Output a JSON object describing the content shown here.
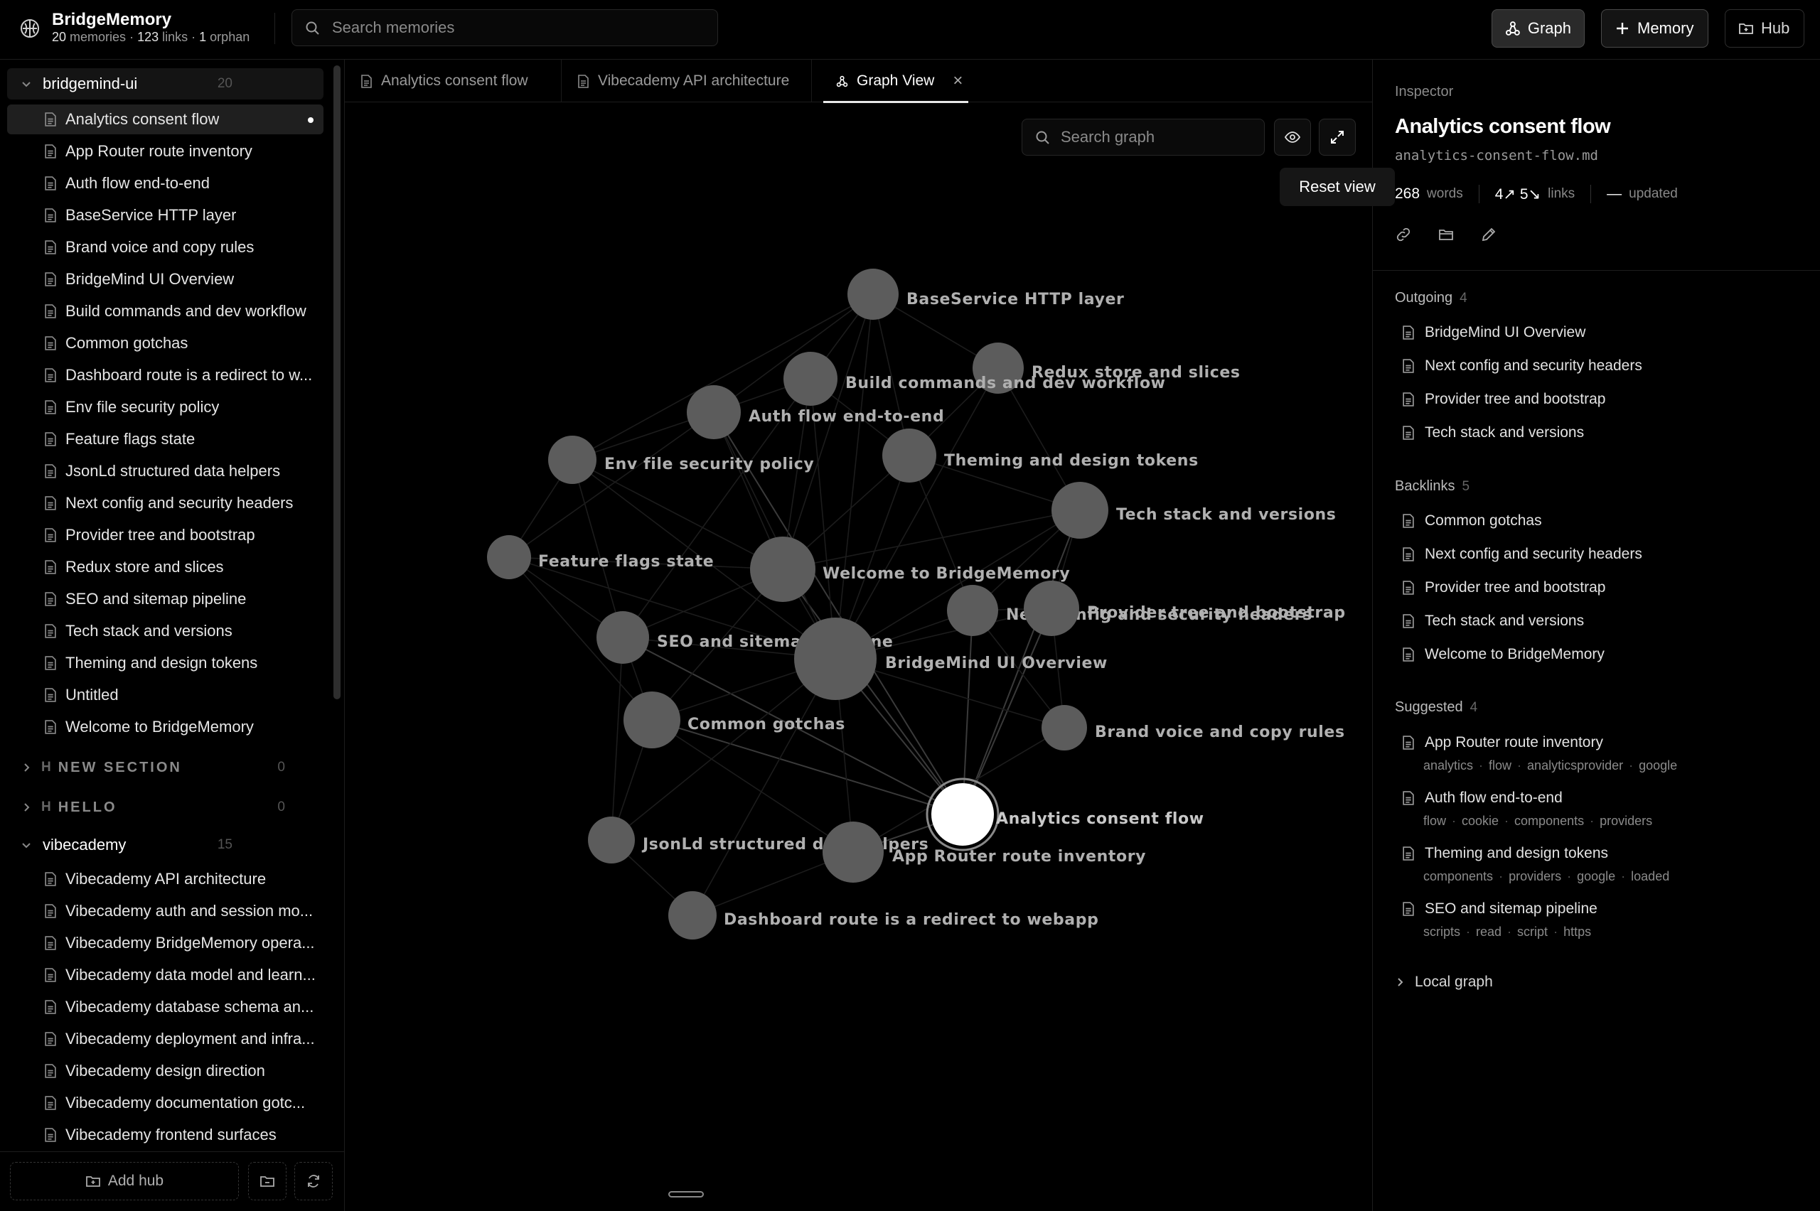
{
  "app": {
    "title": "BridgeMemory",
    "stats": {
      "memories": "20",
      "memories_label": "memories",
      "links": "123",
      "links_label": "links",
      "orphans": "1",
      "orphans_label": "orphan"
    }
  },
  "header": {
    "search_placeholder": "Search memories",
    "graph_button": "Graph",
    "memory_button": "Memory",
    "hub_button": "Hub"
  },
  "sidebar": {
    "groups": [
      {
        "name": "bridgemind-ui",
        "count": "20",
        "items": [
          "Analytics consent flow",
          "App Router route inventory",
          "Auth flow end-to-end",
          "BaseService HTTP layer",
          "Brand voice and copy rules",
          "BridgeMind UI Overview",
          "Build commands and dev workflow",
          "Common gotchas",
          "Dashboard route is a redirect to w...",
          "Env file security policy",
          "Feature flags state",
          "JsonLd structured data helpers",
          "Next config and security headers",
          "Provider tree and bootstrap",
          "Redux store and slices",
          "SEO and sitemap pipeline",
          "Tech stack and versions",
          "Theming and design tokens",
          "Untitled",
          "Welcome to BridgeMemory"
        ]
      },
      {
        "name": "vibecademy",
        "count": "15",
        "items": [
          "Vibecademy API architecture",
          "Vibecademy auth and session mo...",
          "Vibecademy BridgeMemory opera...",
          "Vibecademy data model and learn...",
          "Vibecademy database schema an...",
          "Vibecademy deployment and infra...",
          "Vibecademy design direction",
          "Vibecademy documentation gotc...",
          "Vibecademy frontend surfaces"
        ]
      }
    ],
    "sections": [
      {
        "mark": "H",
        "name": "NEW SECTION",
        "count": "0"
      },
      {
        "mark": "H",
        "name": "HELLO",
        "count": "0"
      }
    ],
    "add_hub": "Add hub"
  },
  "tabs": [
    {
      "label": "Analytics consent flow"
    },
    {
      "label": "Vibecademy API architecture"
    },
    {
      "label": "Graph View",
      "close": "×"
    }
  ],
  "graph": {
    "search_placeholder": "Search graph",
    "tooltip": "Reset view",
    "nodes": [
      {
        "label": "BaseService HTTP layer"
      },
      {
        "label": "Redux store and slices"
      },
      {
        "label": "Build commands and dev workflow"
      },
      {
        "label": "Auth flow end-to-end"
      },
      {
        "label": "Theming and design tokens"
      },
      {
        "label": "Env file security policy"
      },
      {
        "label": "Tech stack and versions"
      },
      {
        "label": "Feature flags state"
      },
      {
        "label": "Welcome to BridgeMemory"
      },
      {
        "label": "Next config and security headers"
      },
      {
        "label": "Provider tree and bootstrap"
      },
      {
        "label": "SEO and sitemap pipeline"
      },
      {
        "label": "BridgeMind UI Overview"
      },
      {
        "label": "Common gotchas"
      },
      {
        "label": "Brand voice and copy rules"
      },
      {
        "label": "Analytics consent flow"
      },
      {
        "label": "JsonLd structured data helpers"
      },
      {
        "label": "App Router route inventory"
      },
      {
        "label": "Dashboard route is a redirect to webapp"
      }
    ]
  },
  "inspector": {
    "label": "Inspector",
    "title": "Analytics consent flow",
    "filename": "analytics-consent-flow.md",
    "words": "268",
    "words_label": "words",
    "outgoing_count": "4↗",
    "backlink_count": "5↘",
    "links_label": "links",
    "updated_value": "—",
    "updated_label": "updated",
    "outgoing": {
      "title": "Outgoing",
      "count": "4",
      "items": [
        "BridgeMind UI Overview",
        "Next config and security headers",
        "Provider tree and bootstrap",
        "Tech stack and versions"
      ]
    },
    "backlinks": {
      "title": "Backlinks",
      "count": "5",
      "items": [
        "Common gotchas",
        "Next config and security headers",
        "Provider tree and bootstrap",
        "Tech stack and versions",
        "Welcome to BridgeMemory"
      ]
    },
    "suggested": {
      "title": "Suggested",
      "count": "4",
      "items": [
        {
          "label": "App Router route inventory",
          "tags": [
            "analytics",
            "flow",
            "analyticsprovider",
            "google"
          ]
        },
        {
          "label": "Auth flow end-to-end",
          "tags": [
            "flow",
            "cookie",
            "components",
            "providers"
          ]
        },
        {
          "label": "Theming and design tokens",
          "tags": [
            "components",
            "providers",
            "google",
            "loaded"
          ]
        },
        {
          "label": "SEO and sitemap pipeline",
          "tags": [
            "scripts",
            "read",
            "script",
            "https"
          ]
        }
      ]
    },
    "local_graph": "Local graph"
  }
}
